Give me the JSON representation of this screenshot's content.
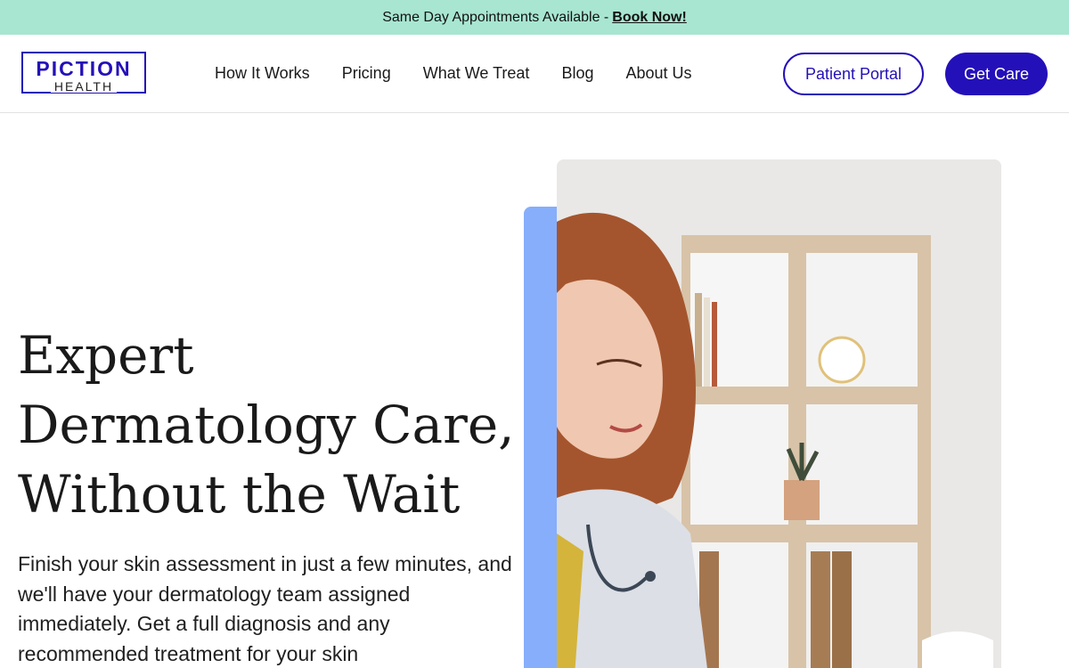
{
  "promo": {
    "text": "Same Day Appointments Available -",
    "link": "Book Now!"
  },
  "header": {
    "logo": {
      "line1": "PICTION",
      "line2": "HEALTH"
    },
    "nav": [
      {
        "label": "How It Works"
      },
      {
        "label": "Pricing"
      },
      {
        "label": "What We Treat"
      },
      {
        "label": "Blog"
      },
      {
        "label": "About Us"
      }
    ],
    "patient_portal": "Patient Portal",
    "get_care": "Get Care"
  },
  "hero": {
    "title_lines": [
      "Expert",
      "Dermatology Care,",
      "Without the Wait"
    ],
    "description": "Finish your skin assessment in just a few minutes, and we'll have your dermatology team assigned immediately. Get a full diagnosis and any recommended treatment for your skin",
    "photo_icon": "doctor-photo"
  },
  "colors": {
    "brand": "#2410b8",
    "promo_bg": "#a8e6d2",
    "accent_blue": "#86aefb"
  }
}
